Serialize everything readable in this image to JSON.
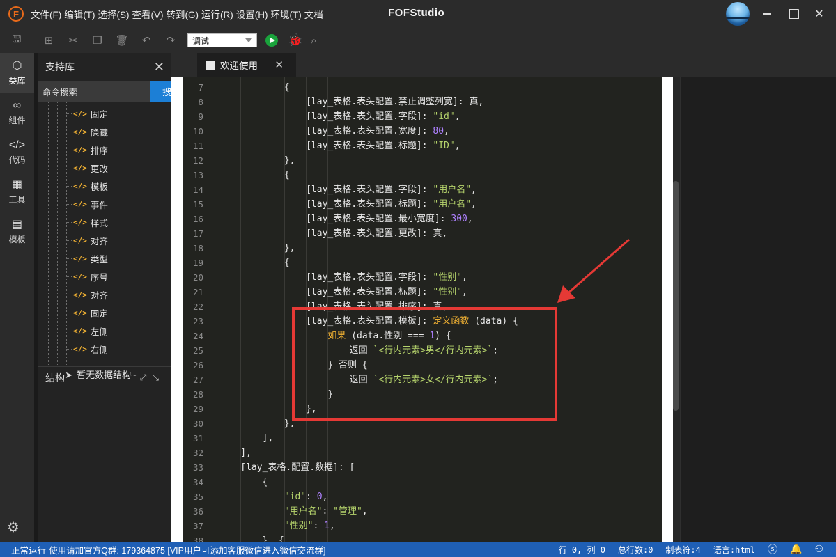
{
  "app": {
    "logo_letter": "F",
    "title": "FOFStudio"
  },
  "menu": [
    "文件(F)",
    "编辑(T)",
    "选择(S)",
    "查看(V)",
    "转到(G)",
    "运行(R)",
    "设置(H)",
    "环境(T)",
    "文档"
  ],
  "toolbar": {
    "mode_select": "调试"
  },
  "activity": [
    {
      "label": "类库",
      "icon": "cube-icon",
      "glyph": "⬡"
    },
    {
      "label": "组件",
      "icon": "link-icon",
      "glyph": "∞"
    },
    {
      "label": "代码",
      "icon": "code-icon",
      "glyph": "</>"
    },
    {
      "label": "工具",
      "icon": "tools-icon",
      "glyph": "▦"
    },
    {
      "label": "模板",
      "icon": "template-icon",
      "glyph": "▤"
    }
  ],
  "sidepanel": {
    "title": "支持库",
    "search_placeholder": "命令搜索",
    "search_button": "搜",
    "tree_items": [
      "固定",
      "隐藏",
      "排序",
      "更改",
      "模板",
      "事件",
      "样式",
      "对齐",
      "类型",
      "序号",
      "对齐",
      "固定",
      "左侧",
      "右侧"
    ],
    "structure_title": "结构",
    "structure_empty": "暂无数据结构~"
  },
  "tab": {
    "label": "欢迎使用"
  },
  "code_lines": [
    {
      "n": "7",
      "indent": 12,
      "parts": [
        [
          "p",
          "{"
        ]
      ]
    },
    {
      "n": "8",
      "indent": 16,
      "parts": [
        [
          "p",
          "[lay_表格.表头配置.禁止调整列宽]: 真,"
        ]
      ]
    },
    {
      "n": "9",
      "indent": 16,
      "parts": [
        [
          "p",
          "[lay_表格.表头配置.字段]: "
        ],
        [
          "s",
          "\"id\""
        ],
        [
          "p",
          ","
        ]
      ]
    },
    {
      "n": "10",
      "indent": 16,
      "parts": [
        [
          "p",
          "[lay_表格.表头配置.宽度]: "
        ],
        [
          "n",
          "80"
        ],
        [
          "p",
          ","
        ]
      ]
    },
    {
      "n": "11",
      "indent": 16,
      "parts": [
        [
          "p",
          "[lay_表格.表头配置.标题]: "
        ],
        [
          "s",
          "\"ID\""
        ],
        [
          "p",
          ","
        ]
      ]
    },
    {
      "n": "12",
      "indent": 12,
      "parts": [
        [
          "p",
          "},"
        ]
      ]
    },
    {
      "n": "13",
      "indent": 12,
      "parts": [
        [
          "p",
          "{"
        ]
      ]
    },
    {
      "n": "14",
      "indent": 16,
      "parts": [
        [
          "p",
          "[lay_表格.表头配置.字段]: "
        ],
        [
          "s",
          "\"用户名\""
        ],
        [
          "p",
          ","
        ]
      ]
    },
    {
      "n": "15",
      "indent": 16,
      "parts": [
        [
          "p",
          "[lay_表格.表头配置.标题]: "
        ],
        [
          "s",
          "\"用户名\""
        ],
        [
          "p",
          ","
        ]
      ]
    },
    {
      "n": "16",
      "indent": 16,
      "parts": [
        [
          "p",
          "[lay_表格.表头配置.最小宽度]: "
        ],
        [
          "n",
          "300"
        ],
        [
          "p",
          ","
        ]
      ]
    },
    {
      "n": "17",
      "indent": 16,
      "parts": [
        [
          "p",
          "[lay_表格.表头配置.更改]: 真,"
        ]
      ]
    },
    {
      "n": "18",
      "indent": 12,
      "parts": [
        [
          "p",
          "},"
        ]
      ]
    },
    {
      "n": "19",
      "indent": 12,
      "parts": [
        [
          "p",
          "{"
        ]
      ]
    },
    {
      "n": "20",
      "indent": 16,
      "parts": [
        [
          "p",
          "[lay_表格.表头配置.字段]: "
        ],
        [
          "s",
          "\"性别\""
        ],
        [
          "p",
          ","
        ]
      ]
    },
    {
      "n": "21",
      "indent": 16,
      "parts": [
        [
          "p",
          "[lay_表格.表头配置.标题]: "
        ],
        [
          "s",
          "\"性别\""
        ],
        [
          "p",
          ","
        ]
      ]
    },
    {
      "n": "22",
      "indent": 16,
      "parts": [
        [
          "p",
          "[lay_表格.表头配置.排序]: 真,"
        ]
      ]
    },
    {
      "n": "23",
      "indent": 16,
      "parts": [
        [
          "p",
          "[lay_表格.表头配置.模板]: "
        ],
        [
          "k",
          "定义函数"
        ],
        [
          "p",
          " (data) {"
        ]
      ]
    },
    {
      "n": "24",
      "indent": 20,
      "parts": [
        [
          "k",
          "如果"
        ],
        [
          "p",
          " (data.性别 === "
        ],
        [
          "n",
          "1"
        ],
        [
          "p",
          ") {"
        ]
      ]
    },
    {
      "n": "25",
      "indent": 24,
      "parts": [
        [
          "p",
          "返回 "
        ],
        [
          "s",
          "`<行内元素>男</行内元素>`"
        ],
        [
          "p",
          ";"
        ]
      ]
    },
    {
      "n": "26",
      "indent": 20,
      "parts": [
        [
          "p",
          "} 否则 {"
        ]
      ]
    },
    {
      "n": "27",
      "indent": 24,
      "parts": [
        [
          "p",
          "返回 "
        ],
        [
          "s",
          "`<行内元素>女</行内元素>`"
        ],
        [
          "p",
          ";"
        ]
      ]
    },
    {
      "n": "28",
      "indent": 20,
      "parts": [
        [
          "p",
          "}"
        ]
      ]
    },
    {
      "n": "29",
      "indent": 16,
      "parts": [
        [
          "p",
          "},"
        ]
      ]
    },
    {
      "n": "30",
      "indent": 12,
      "parts": [
        [
          "p",
          "},"
        ]
      ]
    },
    {
      "n": "31",
      "indent": 8,
      "parts": [
        [
          "p",
          "],"
        ]
      ]
    },
    {
      "n": "32",
      "indent": 4,
      "parts": [
        [
          "p",
          "],"
        ]
      ]
    },
    {
      "n": "33",
      "indent": 4,
      "parts": [
        [
          "p",
          "[lay_表格.配置.数据]: ["
        ]
      ]
    },
    {
      "n": "34",
      "indent": 8,
      "parts": [
        [
          "p",
          "{"
        ]
      ]
    },
    {
      "n": "35",
      "indent": 12,
      "parts": [
        [
          "s",
          "\"id\""
        ],
        [
          "p",
          ": "
        ],
        [
          "n",
          "0"
        ],
        [
          "p",
          ","
        ]
      ]
    },
    {
      "n": "36",
      "indent": 12,
      "parts": [
        [
          "s",
          "\"用户名\""
        ],
        [
          "p",
          ": "
        ],
        [
          "s",
          "\"管理\""
        ],
        [
          "p",
          ","
        ]
      ]
    },
    {
      "n": "37",
      "indent": 12,
      "parts": [
        [
          "s",
          "\"性别\""
        ],
        [
          "p",
          ": "
        ],
        [
          "n",
          "1"
        ],
        [
          "p",
          ","
        ]
      ]
    },
    {
      "n": "38",
      "indent": 8,
      "parts": [
        [
          "p",
          "}, {"
        ]
      ]
    }
  ],
  "status": {
    "left": "正常运行-使用请加官方Q群: 179364875 [VIP用户可添加客服微信进入微信交流群]",
    "position": "行 0, 列 0",
    "total_lines": "总行数:0",
    "tab_size": "制表符:4",
    "language": "语言:html"
  },
  "colors": {
    "status_bar": "#1f5fb5",
    "accent_button": "#1c7fd6",
    "annotation": "#e53935",
    "string": "#b6d46c",
    "number": "#ae81ff",
    "keyword": "#f2b233"
  }
}
